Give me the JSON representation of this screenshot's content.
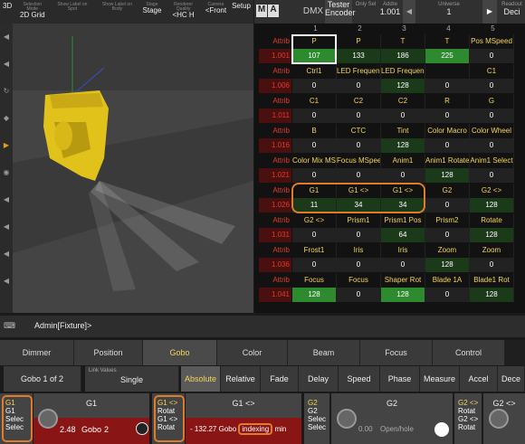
{
  "viewport": {
    "tabs": [
      {
        "sub": "",
        "main": "3D"
      },
      {
        "sub": "Selection Mode",
        "main": "2D Grid"
      },
      {
        "sub": "Show Label on Spot",
        "main": ""
      },
      {
        "sub": "Show Label on Body",
        "main": ""
      },
      {
        "sub": "Stage",
        "main": "Stage"
      },
      {
        "sub": "Renderer Quality",
        "main": "<HC H"
      },
      {
        "sub": "Camera",
        "main": "<Front"
      },
      {
        "sub": "",
        "main": "Setup"
      }
    ]
  },
  "sheet": {
    "header": {
      "icon_m": "M",
      "icon_a": "A",
      "title": "DMX",
      "tester": "Tester Encoder",
      "only_sel": "Only Sel",
      "address_label": "Addre",
      "address_value": "1.001",
      "universe_label": "Universe",
      "universe_value": "1",
      "readout_label": "Readout",
      "readout_value": "Deci"
    },
    "col_numbers": [
      "1",
      "2",
      "3",
      "4",
      "5"
    ],
    "rows": [
      {
        "attrib": "Attrib",
        "dmx": "1.001",
        "labels": [
          "P",
          "P",
          "T",
          "T",
          "Pos MSpeed"
        ],
        "values": [
          "107",
          "133",
          "186",
          "225",
          "0"
        ],
        "colors": [
          "g",
          "dg",
          "dg",
          "g",
          "gr"
        ]
      },
      {
        "attrib": "Attrib",
        "dmx": "1.006",
        "labels": [
          "Ctrl1",
          "LED Frequency",
          "LED Frequency",
          "",
          "C1"
        ],
        "values": [
          "0",
          "0",
          "128",
          "0",
          "0"
        ],
        "colors": [
          "gr",
          "gr",
          "dg",
          "gr",
          "gr"
        ]
      },
      {
        "attrib": "Attrib",
        "dmx": "1.011",
        "labels": [
          "C1",
          "C2",
          "C2",
          "R",
          "G"
        ],
        "values": [
          "0",
          "0",
          "0",
          "0",
          "0"
        ],
        "colors": [
          "gr",
          "gr",
          "gr",
          "gr",
          "gr"
        ]
      },
      {
        "attrib": "Attrib",
        "dmx": "1.016",
        "labels": [
          "B",
          "CTC",
          "Tint",
          "Color Macro",
          "Color Wheel"
        ],
        "values": [
          "0",
          "0",
          "128",
          "0",
          "0"
        ],
        "colors": [
          "gr",
          "gr",
          "dg",
          "gr",
          "gr"
        ]
      },
      {
        "attrib": "Attrib",
        "dmx": "1.021",
        "labels": [
          "Color Mix MSpeed",
          "Focus MSpeed",
          "Anim1",
          "Anim1 Rotate",
          "Anim1 Select"
        ],
        "values": [
          "0",
          "0",
          "0",
          "128",
          "0"
        ],
        "colors": [
          "gr",
          "gr",
          "gr",
          "dg",
          "gr"
        ]
      },
      {
        "attrib": "Attrib",
        "dmx": "1.026",
        "labels": [
          "G1",
          "G1 <>",
          "G1 <>",
          "G2",
          "G2 <>"
        ],
        "values": [
          "11",
          "34",
          "34",
          "0",
          "128"
        ],
        "colors": [
          "dg",
          "dg",
          "dg",
          "gr",
          "dg"
        ]
      },
      {
        "attrib": "Attrib",
        "dmx": "1.031",
        "labels": [
          "G2 <>",
          "Prism1",
          "Prism1 Pos",
          "Prism2",
          "Rotate"
        ],
        "values": [
          "0",
          "0",
          "64",
          "0",
          "128"
        ],
        "colors": [
          "gr",
          "gr",
          "dg",
          "gr",
          "dg"
        ]
      },
      {
        "attrib": "Attrib",
        "dmx": "1.036",
        "labels": [
          "Frost1",
          "Iris",
          "Iris",
          "Zoom",
          "Zoom"
        ],
        "values": [
          "0",
          "0",
          "0",
          "128",
          "0"
        ],
        "colors": [
          "gr",
          "gr",
          "gr",
          "dg",
          "gr"
        ]
      },
      {
        "attrib": "Attrib",
        "dmx": "1.041",
        "labels": [
          "Focus",
          "Focus",
          "Shaper Rot",
          "Blade 1A",
          "Blade1 Rot"
        ],
        "values": [
          "128",
          "0",
          "128",
          "0",
          "128"
        ],
        "colors": [
          "g",
          "gr",
          "g",
          "gr",
          "dg"
        ]
      }
    ]
  },
  "command": {
    "text": "Admin[Fixture]>"
  },
  "features": [
    "Dimmer",
    "Position",
    "Gobo",
    "Color",
    "Beam",
    "Focus",
    "Control"
  ],
  "subbar": {
    "gobo_page": "Gobo 1 of 2",
    "link_label": "Link Values",
    "link_value": "Single",
    "absolute": "Absolute",
    "relative": "Relative",
    "fade": "Fade",
    "delay": "Delay",
    "speed": "Speed",
    "phase": "Phase",
    "measure": "Measure",
    "accel": "Accel",
    "decel": "Dece"
  },
  "encoders": {
    "e1": {
      "side": [
        "G1",
        "G1",
        "Selec",
        "Selec"
      ],
      "title": "G1",
      "value": "2.48",
      "unit": "Gobo",
      "sub": "2"
    },
    "e2": {
      "side": [
        "G1 <>",
        "Rotat",
        "G1 <>",
        "Rotat"
      ],
      "title": "G1 <>",
      "value": "- 132.27",
      "unit": "Gobo",
      "mode": "indexing",
      "suffix": "min"
    },
    "e3": {
      "side": [
        "G2",
        "G2",
        "Selec",
        "Selec"
      ],
      "title": "G2",
      "value": "0.00",
      "unit": "Open/hole"
    },
    "e4": {
      "side": [
        "G2 <>",
        "Rotat",
        "G2 <>",
        "Rotat"
      ],
      "title": "G2 <>"
    }
  }
}
